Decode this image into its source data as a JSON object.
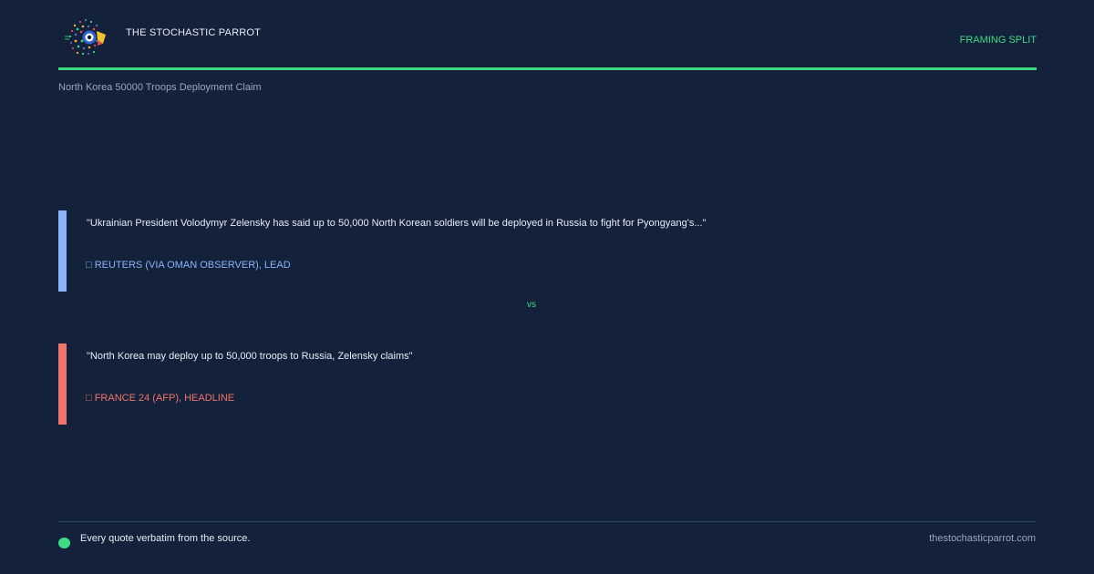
{
  "header": {
    "brand": "THE STOCHASTIC PARROT",
    "badge": "FRAMING SPLIT"
  },
  "topic": "North Korea 50000 Troops Deployment Claim",
  "cards": [
    {
      "quote": "\"Ukrainian President Volodymyr Zelensky has said up to 50,000 North Korean soldiers will be deployed in Russia to fight for Pyongyang's...\"",
      "source": "□ REUTERS (VIA OMAN OBSERVER), LEAD",
      "color": "#8ab4f8"
    },
    {
      "quote": "\"North Korea may deploy up to 50,000 troops to Russia, Zelensky claims\"",
      "source": "□ FRANCE 24 (AFP), HEADLINE",
      "color": "#f0746a"
    }
  ],
  "separator": "vs",
  "footer": {
    "note": "Every quote verbatim from the source.",
    "url": "thestochasticparrot.com"
  },
  "colors": {
    "background": "#13213b",
    "accent": "#3ddc84"
  },
  "icons": {
    "logo": "parrot-logo-icon",
    "footer": "green-dot-icon"
  }
}
